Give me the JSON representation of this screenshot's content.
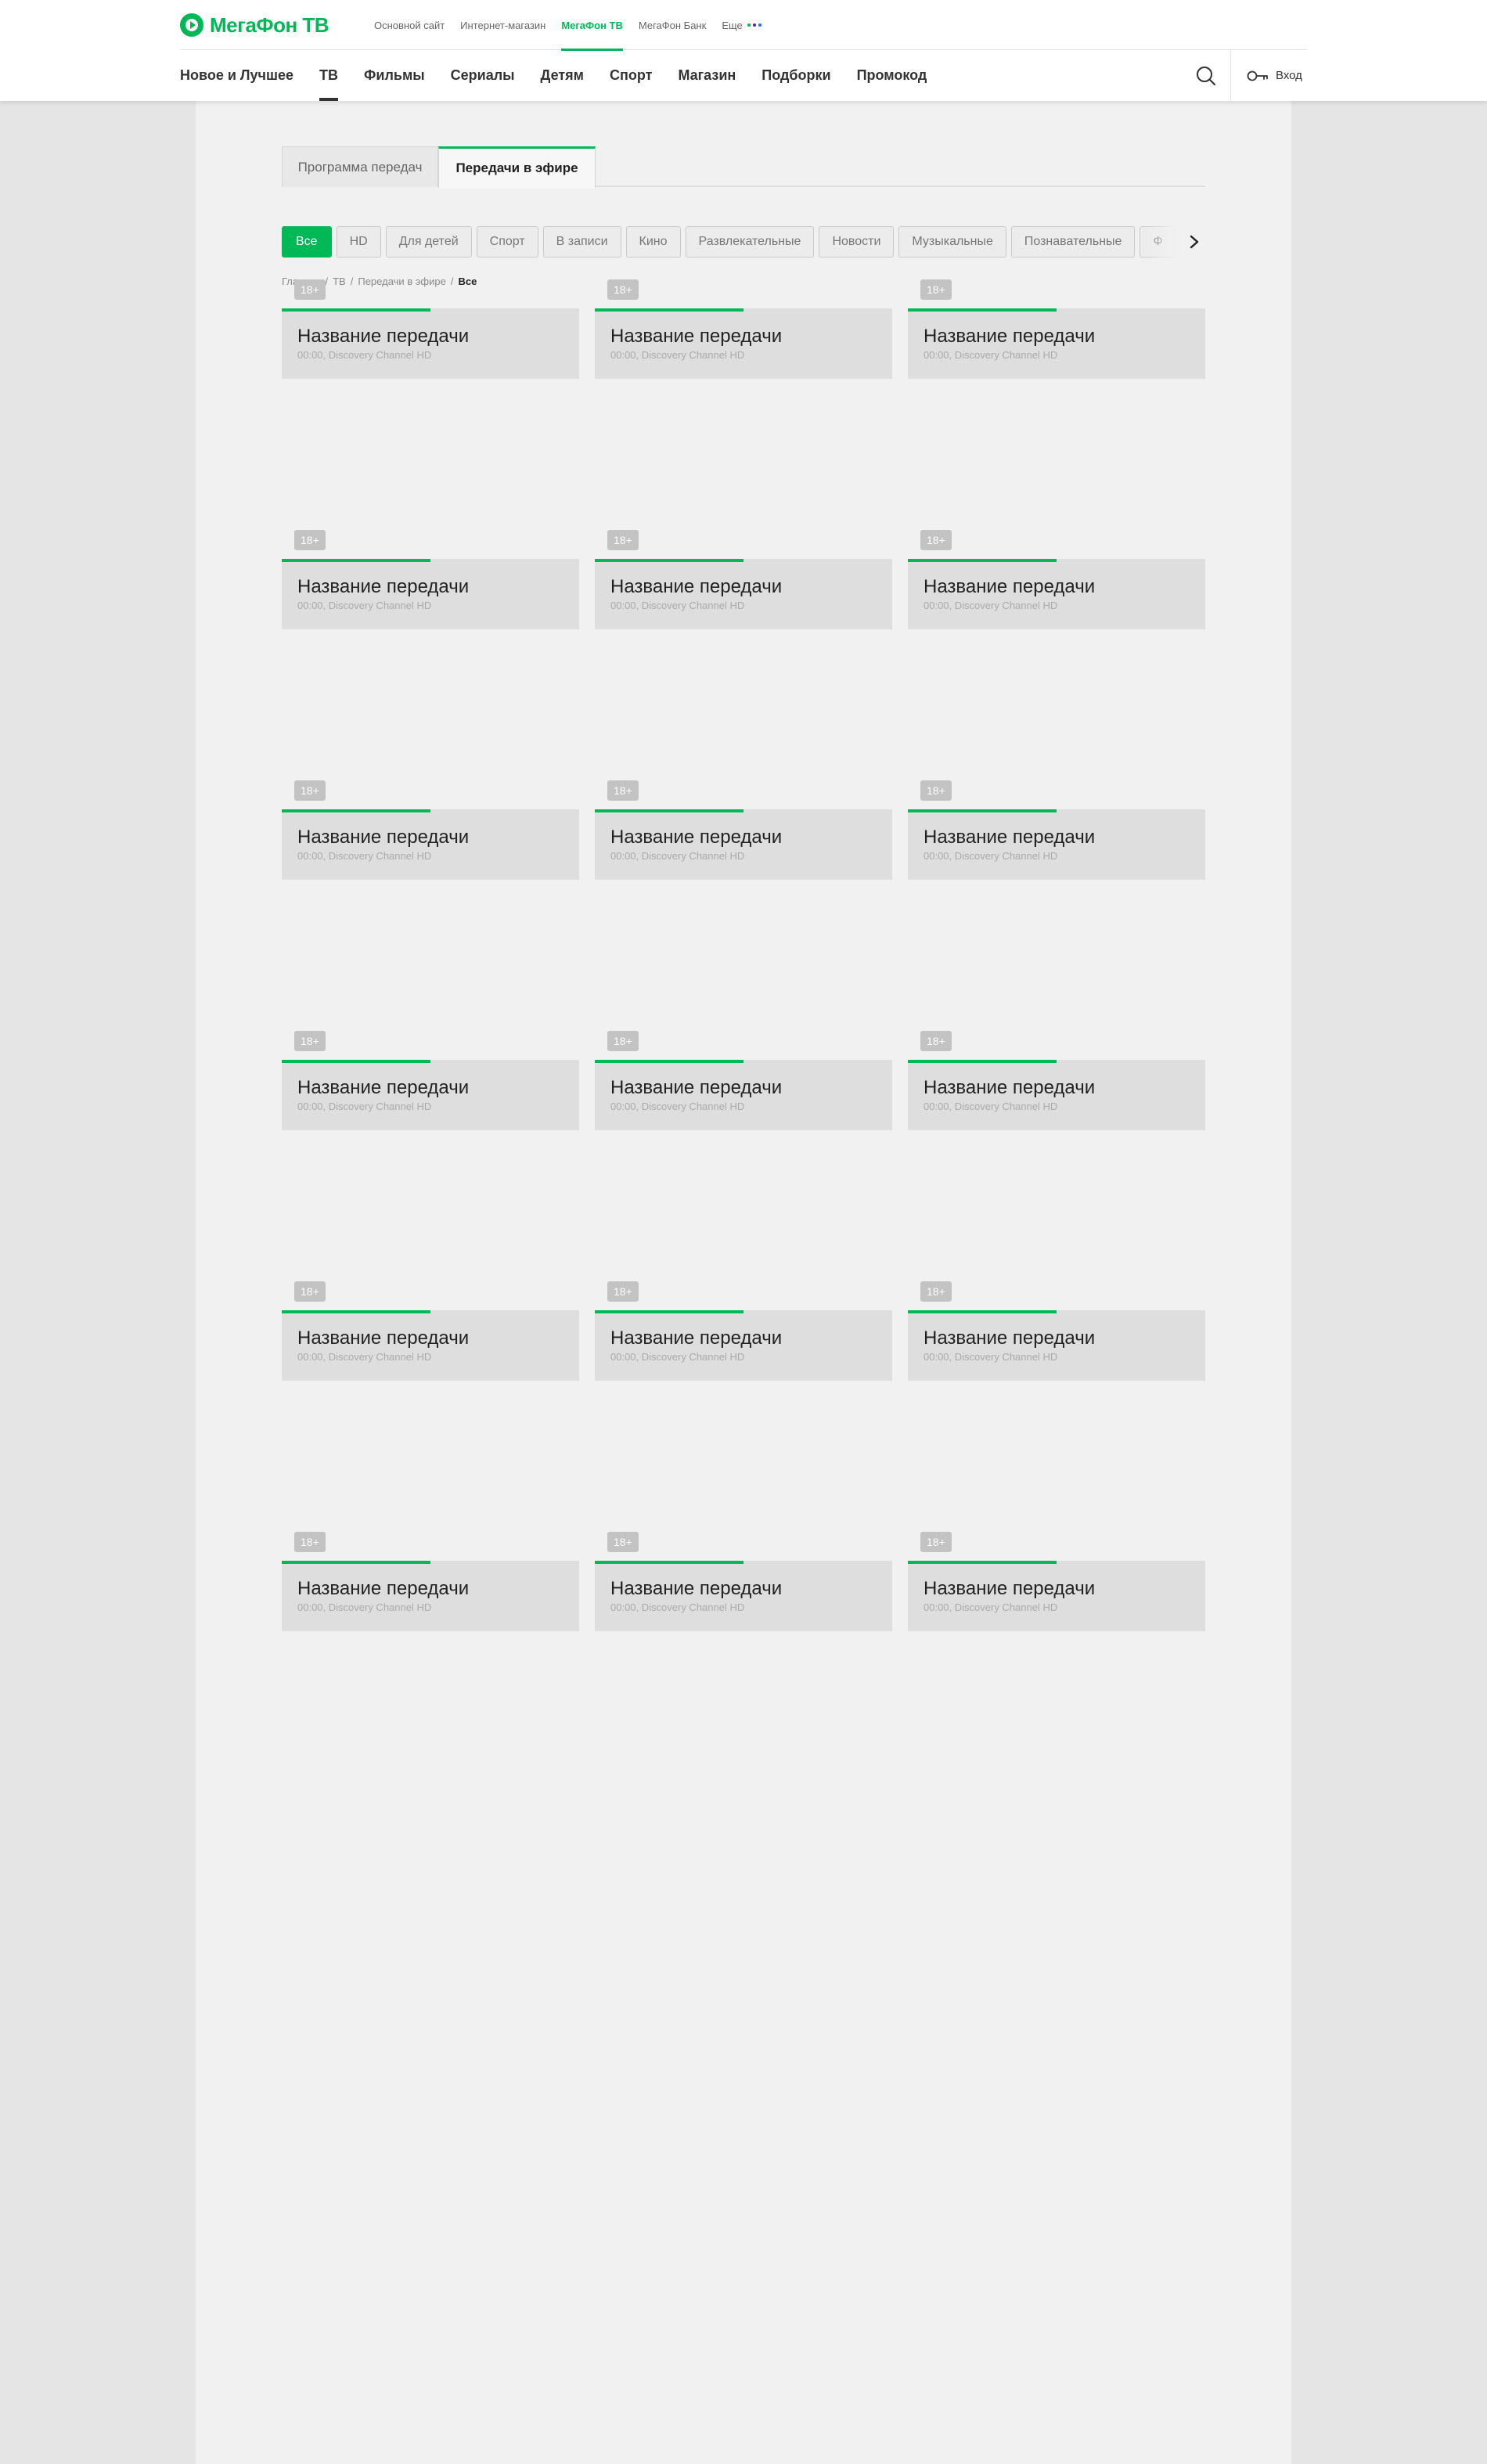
{
  "brand": {
    "logo_text": "МегаФон ТВ",
    "accent_color": "#00b956"
  },
  "top_links": [
    {
      "label": "Основной сайт",
      "active": false
    },
    {
      "label": "Интернет-магазин",
      "active": false
    },
    {
      "label": "МегаФон ТВ",
      "active": true
    },
    {
      "label": "МегаФон Банк",
      "active": false
    },
    {
      "label": "Еще",
      "active": false
    }
  ],
  "more_dots_colors": [
    "#00b956",
    "#731982",
    "#1a73e8"
  ],
  "nav": [
    {
      "label": "Новое и Лучшее",
      "active": false
    },
    {
      "label": "ТВ",
      "active": true
    },
    {
      "label": "Фильмы",
      "active": false
    },
    {
      "label": "Сериалы",
      "active": false
    },
    {
      "label": "Детям",
      "active": false
    },
    {
      "label": "Спорт",
      "active": false
    },
    {
      "label": "Магазин",
      "active": false
    },
    {
      "label": "Подборки",
      "active": false
    },
    {
      "label": "Промокод",
      "active": false
    }
  ],
  "header_actions": {
    "search_icon": "search-icon",
    "login_icon": "key-icon",
    "login_label": "Вход"
  },
  "tabs": [
    {
      "label": "Программа передач",
      "active": false
    },
    {
      "label": "Передачи в эфире",
      "active": true
    }
  ],
  "filters": [
    {
      "label": "Все",
      "active": true
    },
    {
      "label": "HD",
      "active": false
    },
    {
      "label": "Для детей",
      "active": false
    },
    {
      "label": "Спорт",
      "active": false
    },
    {
      "label": "В записи",
      "active": false
    },
    {
      "label": "Кино",
      "active": false
    },
    {
      "label": "Развлекательные",
      "active": false
    },
    {
      "label": "Новости",
      "active": false
    },
    {
      "label": "Музыкальные",
      "active": false
    },
    {
      "label": "Познавательные",
      "active": false
    },
    {
      "label": "Ф",
      "active": false
    }
  ],
  "filters_next_icon": "chevron-right-icon",
  "breadcrumb": {
    "items": [
      "Главная",
      "ТВ",
      "Передачи в эфире",
      "Все"
    ],
    "separator": "/"
  },
  "cards": [
    {
      "badge": "18+",
      "title": "Название передачи",
      "meta": "00:00, Discovery Channel HD",
      "progress": 0.5
    },
    {
      "badge": "18+",
      "title": "Название передачи",
      "meta": "00:00, Discovery Channel HD",
      "progress": 0.5
    },
    {
      "badge": "18+",
      "title": "Название передачи",
      "meta": "00:00, Discovery Channel HD",
      "progress": 0.5
    },
    {
      "badge": "18+",
      "title": "Название передачи",
      "meta": "00:00, Discovery Channel HD",
      "progress": 0.5
    },
    {
      "badge": "18+",
      "title": "Название передачи",
      "meta": "00:00, Discovery Channel HD",
      "progress": 0.5
    },
    {
      "badge": "18+",
      "title": "Название передачи",
      "meta": "00:00, Discovery Channel HD",
      "progress": 0.5
    },
    {
      "badge": "18+",
      "title": "Название передачи",
      "meta": "00:00, Discovery Channel HD",
      "progress": 0.5
    },
    {
      "badge": "18+",
      "title": "Название передачи",
      "meta": "00:00, Discovery Channel HD",
      "progress": 0.5
    },
    {
      "badge": "18+",
      "title": "Название передачи",
      "meta": "00:00, Discovery Channel HD",
      "progress": 0.5
    },
    {
      "badge": "18+",
      "title": "Название передачи",
      "meta": "00:00, Discovery Channel HD",
      "progress": 0.5
    },
    {
      "badge": "18+",
      "title": "Название передачи",
      "meta": "00:00, Discovery Channel HD",
      "progress": 0.5
    },
    {
      "badge": "18+",
      "title": "Название передачи",
      "meta": "00:00, Discovery Channel HD",
      "progress": 0.5
    },
    {
      "badge": "18+",
      "title": "Название передачи",
      "meta": "00:00, Discovery Channel HD",
      "progress": 0.5
    },
    {
      "badge": "18+",
      "title": "Название передачи",
      "meta": "00:00, Discovery Channel HD",
      "progress": 0.5
    },
    {
      "badge": "18+",
      "title": "Название передачи",
      "meta": "00:00, Discovery Channel HD",
      "progress": 0.5
    },
    {
      "badge": "18+",
      "title": "Название передачи",
      "meta": "00:00, Discovery Channel HD",
      "progress": 0.5
    },
    {
      "badge": "18+",
      "title": "Название передачи",
      "meta": "00:00, Discovery Channel HD",
      "progress": 0.5
    },
    {
      "badge": "18+",
      "title": "Название передачи",
      "meta": "00:00, Discovery Channel HD",
      "progress": 0.5
    }
  ]
}
